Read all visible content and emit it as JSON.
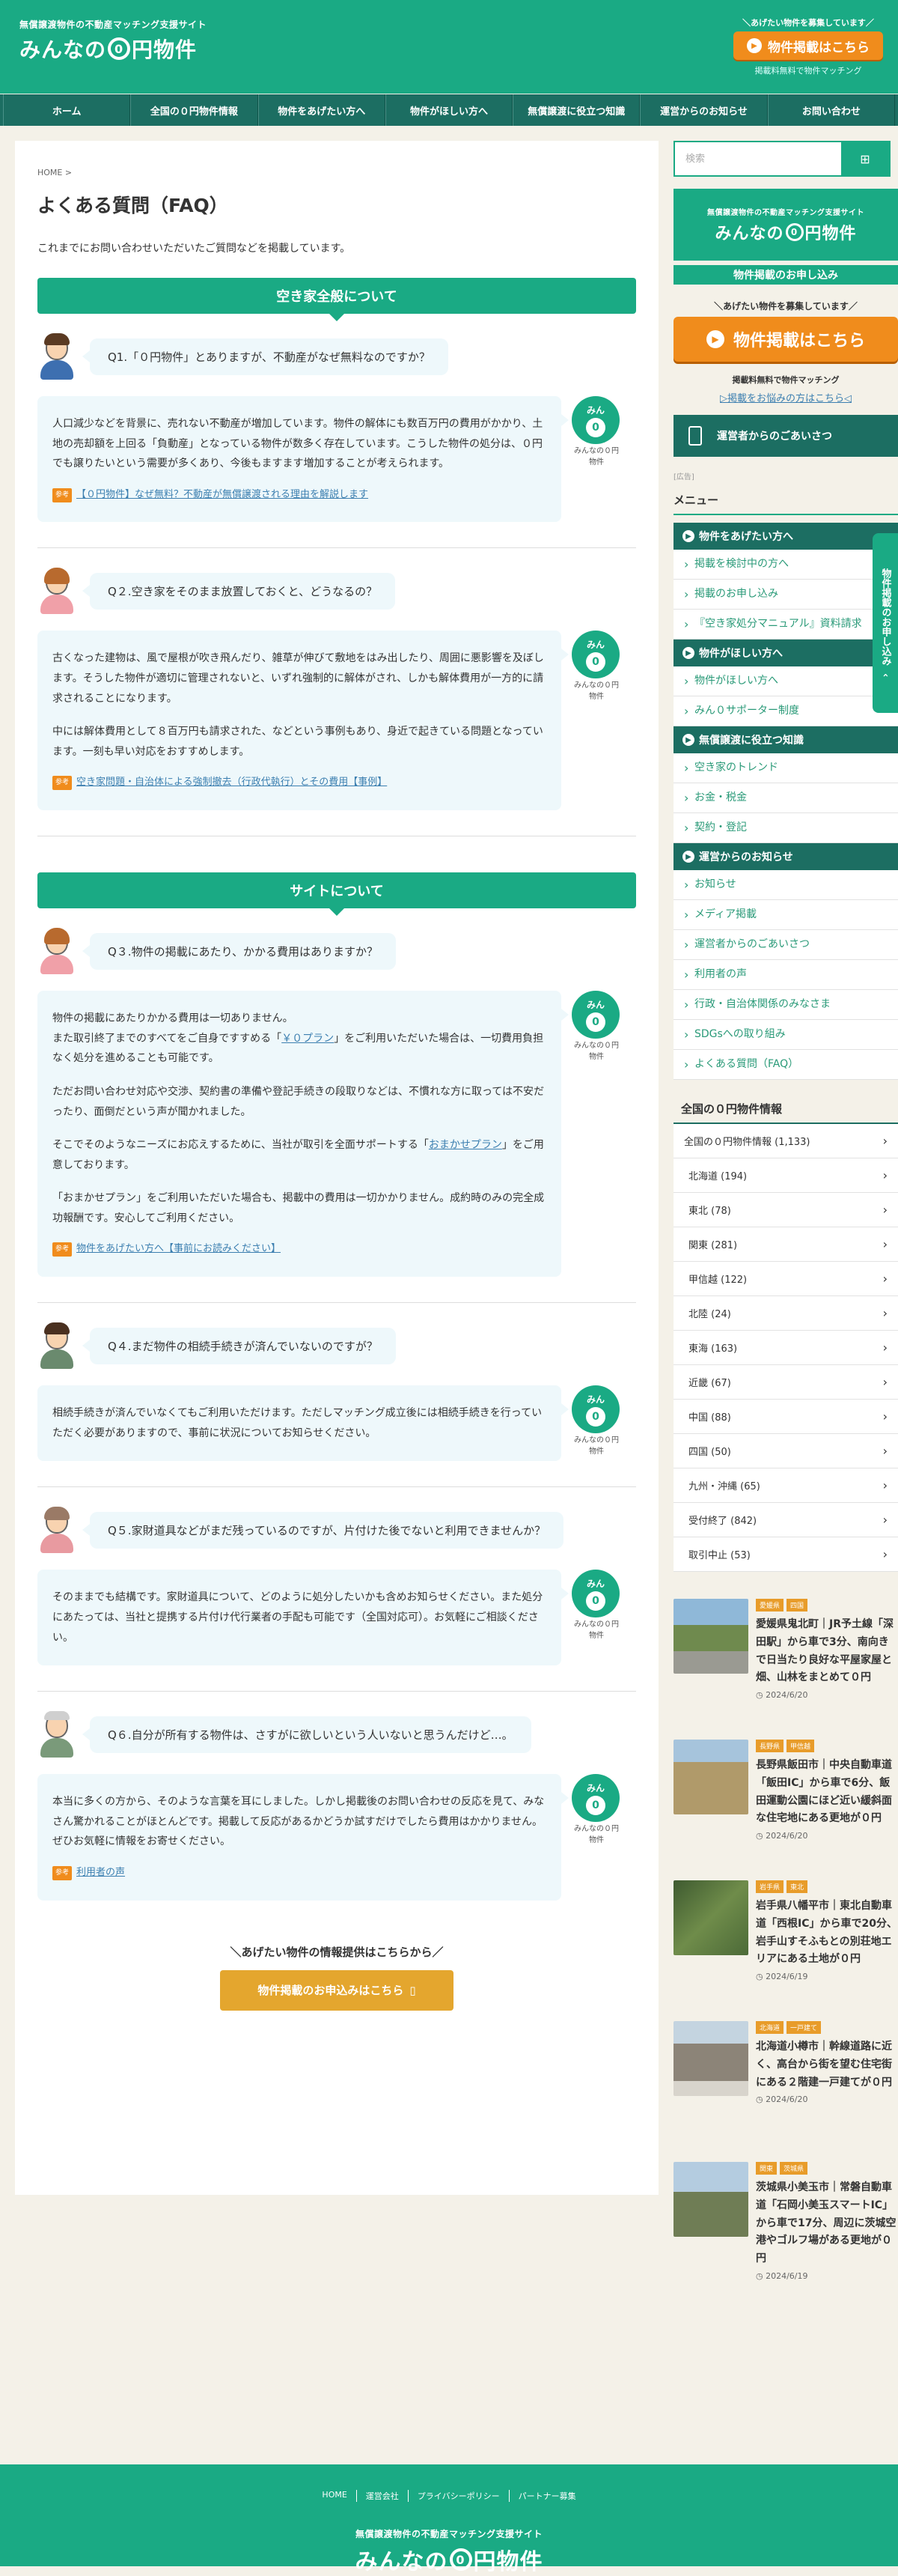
{
  "header": {
    "tagline": "無償譲渡物件の不動産マッチング支援サイト",
    "logo_pre": "みんなの",
    "logo_zero": "0",
    "logo_post": "円物件",
    "cta_note": "＼あげたい物件を募集しています／",
    "cta_label": "物件掲載はこちら",
    "cta_sub": "掲載料無料で物件マッチング"
  },
  "nav": [
    "ホーム",
    "全国の０円物件情報",
    "物件をあげたい方へ",
    "物件がほしい方へ",
    "無償譲渡に役立つ知識",
    "運営からのお知らせ",
    "お問い合わせ"
  ],
  "main": {
    "breadcrumb": "HOME >",
    "title": "よくある質問（FAQ）",
    "intro": "これまでにお問い合わせいただいたご質問などを掲載しています。",
    "sections": [
      {
        "heading": "空き家全般について",
        "faqs": [
          {
            "q": "Q1.「０円物件」とありますが、不動産がなぜ無料なのですか？",
            "a": [
              "人口減少などを背景に、売れない不動産が増加しています。物件の解体にも数百万円の費用がかかり、土地の売却額を上回る「負動産」となっている物件が数多く存在しています。こうした物件の処分は、０円でも譲りたいという需要が多くあり、今後もますます増加することが考えられます。"
            ],
            "ref": "【０円物件】なぜ無料？不動産が無償譲渡される理由を解説します"
          },
          {
            "q": "Q２.空き家をそのまま放置しておくと、どうなるの？",
            "a": [
              "古くなった建物は、風で屋根が吹き飛んだり、雑草が伸びて敷地をはみ出したり、周囲に悪影響を及ぼします。そうした物件が適切に管理されないと、いずれ強制的に解体がされ、しかも解体費用が一方的に請求されることになります。",
              "中には解体費用として８百万円も請求された、などという事例もあり、身近で起きている問題となっています。一刻も早い対応をおすすめします。"
            ],
            "ref": "空き家問題・自治体による強制撤去（行政代執行）とその費用【事例】"
          }
        ]
      },
      {
        "heading": "サイトについて",
        "faqs": [
          {
            "q": "Q３.物件の掲載にあたり、かかる費用はありますか？",
            "a": [
              "物件の掲載にあたりかかる費用は一切ありません。",
              "ただお問い合わせ対応や交渉、契約書の準備や登記手続きの段取りなどは、不慣れな方に取っては不安だったり、面倒だという声が聞かれました。",
              "「おまかせプラン」をご利用いただいた場合も、掲載中の費用は一切かかりません。成約時のみの完全成功報酬です。安心してご利用ください。"
            ],
            "a_q3_line2_pre": "また取引終了までのすべてをご自身ですすめる「",
            "a_q3_line2_link": "￥０プラン",
            "a_q3_line2_post": "」をご利用いただいた場合は、一切費用負担なく処分を進めることも可能です。",
            "a_q3_line4_pre": "そこでそのようなニーズにお応えするために、当社が取引を全面サポートする「",
            "a_q3_line4_link": "おまかせプラン",
            "a_q3_line4_post": "」をご用意しております。",
            "ref": "物件をあげたい方へ【事前にお読みください】"
          },
          {
            "q": "Q４.まだ物件の相続手続きが済んでいないのですが？",
            "a": [
              "相続手続きが済んでいなくてもご利用いただけます。ただしマッチング成立後には相続手続きを行っていただく必要がありますので、事前に状況についてお知らせください。"
            ]
          },
          {
            "q": "Q５.家財道具などがまだ残っているのですが、片付けた後でないと利用できませんか？",
            "a": [
              "そのままでも結構です。家財道具について、どのように処分したいかも含めお知らせください。また処分にあたっては、当社と提携する片付け代行業者の手配も可能です（全国対応可）。お気軽にご相談ください。"
            ]
          },
          {
            "q": "Q６.自分が所有する物件は、さすがに欲しいという人いないと思うんだけど…。",
            "a": [
              "本当に多くの方から、そのような言葉を耳にしました。しかし掲載後のお問い合わせの反応を見て、みなさん驚かれることがほとんどです。掲載して反応があるかどうか試すだけでしたら費用はかかりません。ぜひお気軽に情報をお寄せください。"
            ],
            "ref": "利用者の声"
          }
        ]
      }
    ],
    "ref_tag": "参考",
    "mascot_top": "みん",
    "mascot_zero": "0",
    "mascot_label": "みんなの０円物件",
    "bottom_note": "＼あげたい物件の情報提供はこちらから／",
    "bottom_btn": "物件掲載のお申込みはこちら"
  },
  "sidebar": {
    "search_placeholder": "検索",
    "banner_tag": "無償譲渡物件の不動産マッチング支援サイト",
    "apply": "物件掲載のお申し込み",
    "cta_note": "＼あげたい物件を募集しています／",
    "cta_label": "物件掲載はこちら",
    "cta_sub": "掲載料無料で物件マッチング",
    "cta_link": "▷掲載をお悩みの方はこちら◁",
    "greet": "運営者からのごあいさつ",
    "ad": "[広告]",
    "menu_title": "メニュー",
    "menu": [
      {
        "head": "物件をあげたい方へ",
        "items": [
          "掲載を検討中の方へ",
          "掲載のお申し込み",
          "『空き家処分マニュアル』資料請求"
        ]
      },
      {
        "head": "物件がほしい方へ",
        "items": [
          "物件がほしい方へ",
          "みん０サポーター制度"
        ]
      },
      {
        "head": "無償譲渡に役立つ知識",
        "items": [
          "空き家のトレンド",
          "お金・税金",
          "契約・登記"
        ]
      },
      {
        "head": "運営からのお知らせ",
        "items": [
          "お知らせ",
          "メディア掲載",
          "運営者からのごあいさつ",
          "利用者の声",
          "行政・自治体関係のみなさま",
          "SDGsへの取り組み",
          "よくある質問（FAQ）"
        ]
      }
    ],
    "area_title": "全国の０円物件情報",
    "areas": [
      "全国の０円物件情報 (1,133)",
      "北海道 (194)",
      "東北 (78)",
      "関東 (281)",
      "甲信越 (122)",
      "北陸 (24)",
      "東海 (163)",
      "近畿 (67)",
      "中国 (88)",
      "四国 (50)",
      "九州・沖縄 (65)",
      "受付終了 (842)",
      "取引中止 (53)"
    ],
    "posts": [
      {
        "tags": [
          "愛媛県",
          "四国"
        ],
        "title": "愛媛県鬼北町｜JR予土線「深田駅」から車で3分、南向きで日当たり良好な平屋家屋と畑、山林をまとめて０円",
        "date": "2024/6/20",
        "color": "#7a8a5a"
      },
      {
        "tags": [
          "長野県",
          "甲信越"
        ],
        "title": "長野県飯田市｜中央自動車道「飯田IC」から車で6分、飯田運動公園にほど近い緩斜面な住宅地にある更地が０円",
        "date": "2024/6/20",
        "color": "#a08c5e"
      },
      {
        "tags": [
          "岩手県",
          "東北"
        ],
        "title": "岩手県八幡平市｜東北自動車道「西根IC」から車で20分、岩手山すそふもとの別荘地エリアにある土地が０円",
        "date": "2024/6/19",
        "color": "#5f7a4a"
      },
      {
        "tags": [
          "北海道",
          "一戸建て"
        ],
        "title": "北海道小樽市｜幹線道路に近く、高台から街を望む住宅街にある２階建一戸建てが０円",
        "date": "2024/6/20",
        "color": "#8c8478"
      },
      {
        "tags": [
          "関東",
          "茨城県"
        ],
        "title": "茨城県小美玉市｜常磐自動車道「石岡小美玉スマートIC」から車で17分、周辺に茨城空港やゴルフ場がある更地が０円",
        "date": "2024/6/19",
        "color": "#6f7d55"
      }
    ],
    "side_tab": "物件掲載のお申し込み"
  },
  "footer": {
    "links": [
      "HOME",
      "運営会社",
      "プライバシーポリシー",
      "パートナー募集"
    ],
    "tagline": "無償譲渡物件の不動産マッチング支援サイト"
  }
}
